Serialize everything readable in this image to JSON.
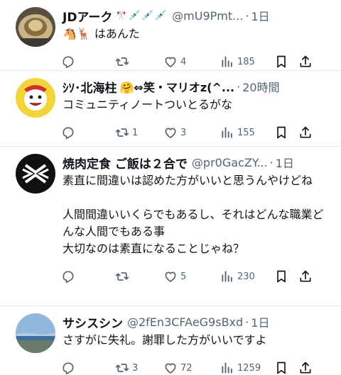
{
  "tweets": [
    {
      "name": "JDアーク",
      "name_emoji": "🎌💉💉💉",
      "handle": "@mU9Pmt...",
      "time": "1日",
      "text": "🐴🦌 はあんた",
      "replies": "",
      "retweets": "",
      "likes": "4",
      "views": "185"
    },
    {
      "name": "ｼｿ･北海柱",
      "name_emoji": "🤗⇔笑・マリオz(^...",
      "handle": "",
      "time": "20時間",
      "text": "コミュニティノートついとるがな",
      "replies": "",
      "retweets": "1",
      "likes": "3",
      "views": "155"
    },
    {
      "name": "焼肉定食 ご飯は２合で",
      "name_emoji": "",
      "handle": "@pr0GacZY...",
      "time": "1日",
      "text": "素直に間違いは認めた方がいいと思うんやけどね\n\n人間間違いいくらでもあるし、それはどんな職業どんな人間でもある事\n大切なのは素直になることじゃね？",
      "replies": "",
      "retweets": "",
      "likes": "5",
      "views": "230"
    },
    {
      "name": "サシスシン",
      "name_emoji": "",
      "handle": "@2fEn3CFAeG9sBxd",
      "time": "1日",
      "text": "さすがに失礼。謝罪した方がいいですよ",
      "replies": "",
      "retweets": "3",
      "likes": "72",
      "views": "1259"
    }
  ],
  "icons": {
    "reply": "reply-icon",
    "retweet": "retweet-icon",
    "like": "heart-icon",
    "views": "views-icon",
    "bookmark": "bookmark-icon",
    "share": "share-icon"
  },
  "colors": {
    "text": "#0f1419",
    "muted": "#536471",
    "divider": "#e7e9eb"
  }
}
